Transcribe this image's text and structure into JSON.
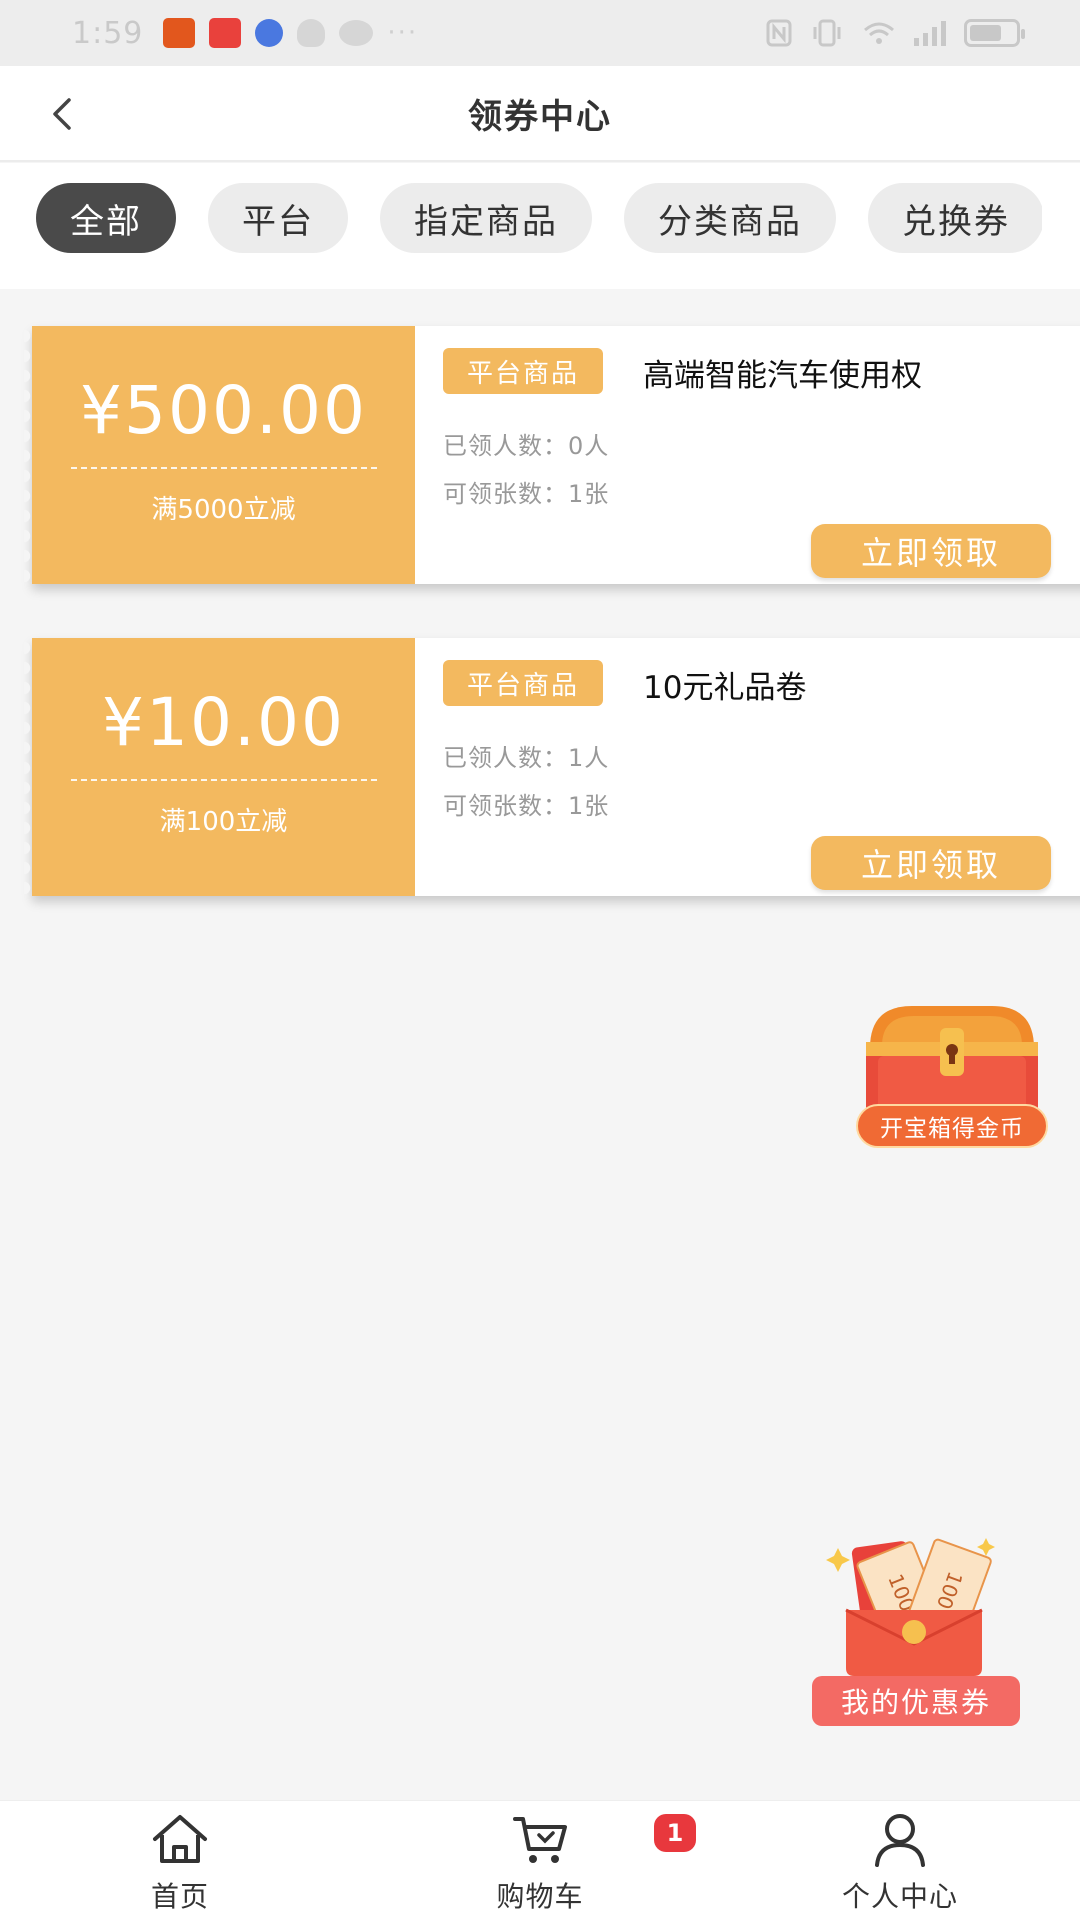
{
  "status_bar": {
    "time": "1:59",
    "dots": "···"
  },
  "header": {
    "title": "领券中心"
  },
  "tabs": [
    {
      "label": "全部",
      "active": true
    },
    {
      "label": "平台",
      "active": false
    },
    {
      "label": "指定商品",
      "active": false
    },
    {
      "label": "分类商品",
      "active": false
    },
    {
      "label": "兑换券",
      "active": false
    }
  ],
  "coupons": [
    {
      "amount": "¥500.00",
      "condition": "满5000立减",
      "tag": "平台商品",
      "name": "高端智能汽车使用权",
      "claimed": "已领人数：0人",
      "limit": "可领张数：1张",
      "button": "立即领取"
    },
    {
      "amount": "¥10.00",
      "condition": "满100立减",
      "tag": "平台商品",
      "name": "10元礼品卷",
      "claimed": "已领人数：1人",
      "limit": "可领张数：1张",
      "button": "立即领取"
    }
  ],
  "floating": {
    "treasure_label": "开宝箱得金币",
    "my_coupons_label": "我的优惠券",
    "coupon_art_text": "100"
  },
  "bottom_nav": [
    {
      "label": "首页",
      "icon": "home-icon"
    },
    {
      "label": "购物车",
      "icon": "cart-icon",
      "badge": "1"
    },
    {
      "label": "个人中心",
      "icon": "user-icon"
    }
  ],
  "colors": {
    "coupon_accent": "#f3b95f",
    "active_tab": "#4a4a4a",
    "badge": "#e8383d",
    "my_coupons": "#f36a64"
  }
}
